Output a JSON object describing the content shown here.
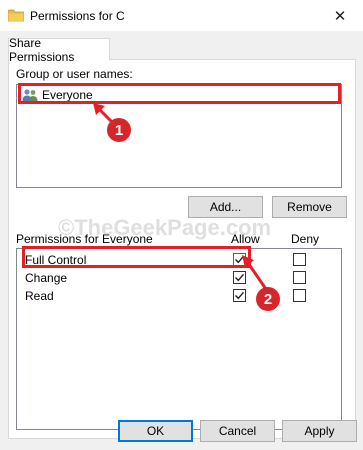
{
  "window": {
    "title": "Permissions for C",
    "close_glyph": "✕"
  },
  "tabs": [
    {
      "label": "Share Permissions",
      "active": true
    }
  ],
  "group_section": {
    "label": "Group or user names:",
    "users": [
      {
        "name": "Everyone",
        "icon": "users-group-icon",
        "selected": true
      }
    ]
  },
  "buttons": {
    "add": "Add...",
    "remove": "Remove",
    "ok": "OK",
    "cancel": "Cancel",
    "apply": "Apply"
  },
  "permissions_section": {
    "label": "Permissions for Everyone",
    "allow_header": "Allow",
    "deny_header": "Deny",
    "rows": [
      {
        "name": "Full Control",
        "allow": true,
        "deny": false
      },
      {
        "name": "Change",
        "allow": true,
        "deny": false
      },
      {
        "name": "Read",
        "allow": true,
        "deny": false
      }
    ]
  },
  "annotations": [
    {
      "number": "1"
    },
    {
      "number": "2"
    }
  ],
  "watermark": "©TheGeekPage.com",
  "colors": {
    "annotation_red": "#e3202a",
    "focus_blue": "#0078d7",
    "dialog_bg": "#f0f0f0"
  }
}
